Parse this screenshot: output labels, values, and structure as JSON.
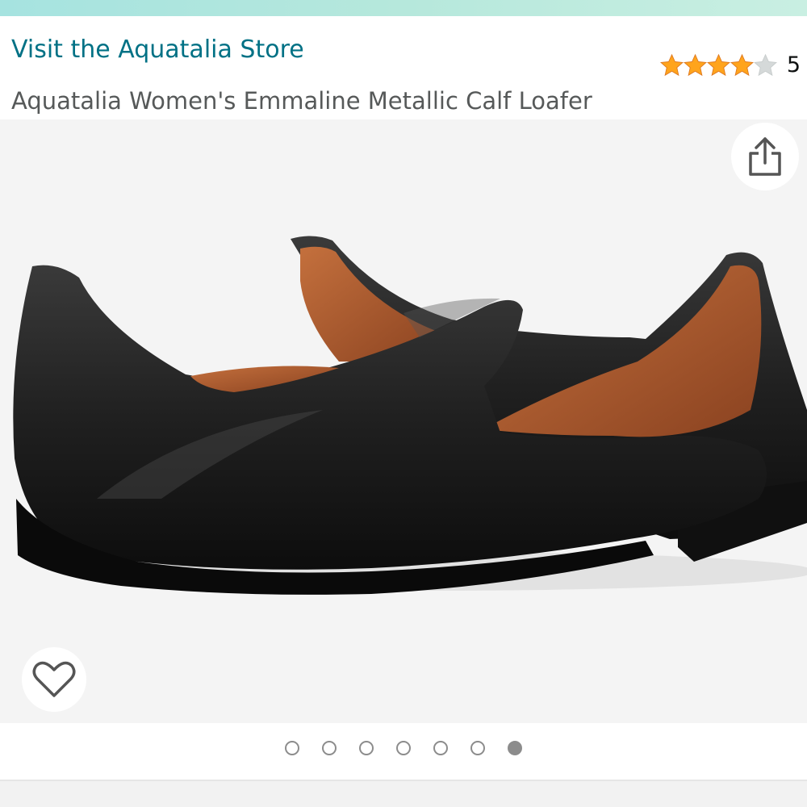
{
  "header": {
    "store_link": "Visit the Aquatalia Store",
    "product_title": "Aquatalia Women's Emmaline Metallic Calf Loafer"
  },
  "rating": {
    "stars": 4,
    "max_stars": 5,
    "count": "5",
    "star_color": "#ffa41c",
    "empty_star_color": "#d5d9d9"
  },
  "gallery": {
    "image_subject": "pair of black leather loafers with brown leather lining",
    "share_icon": "share-icon",
    "wishlist_icon": "heart-icon",
    "image_count": 7,
    "active_index": 7
  },
  "colors": {
    "link": "#007185",
    "title": "#565959",
    "gallery_bg": "#f4f4f4",
    "top_accent": "#a6e3e0"
  }
}
